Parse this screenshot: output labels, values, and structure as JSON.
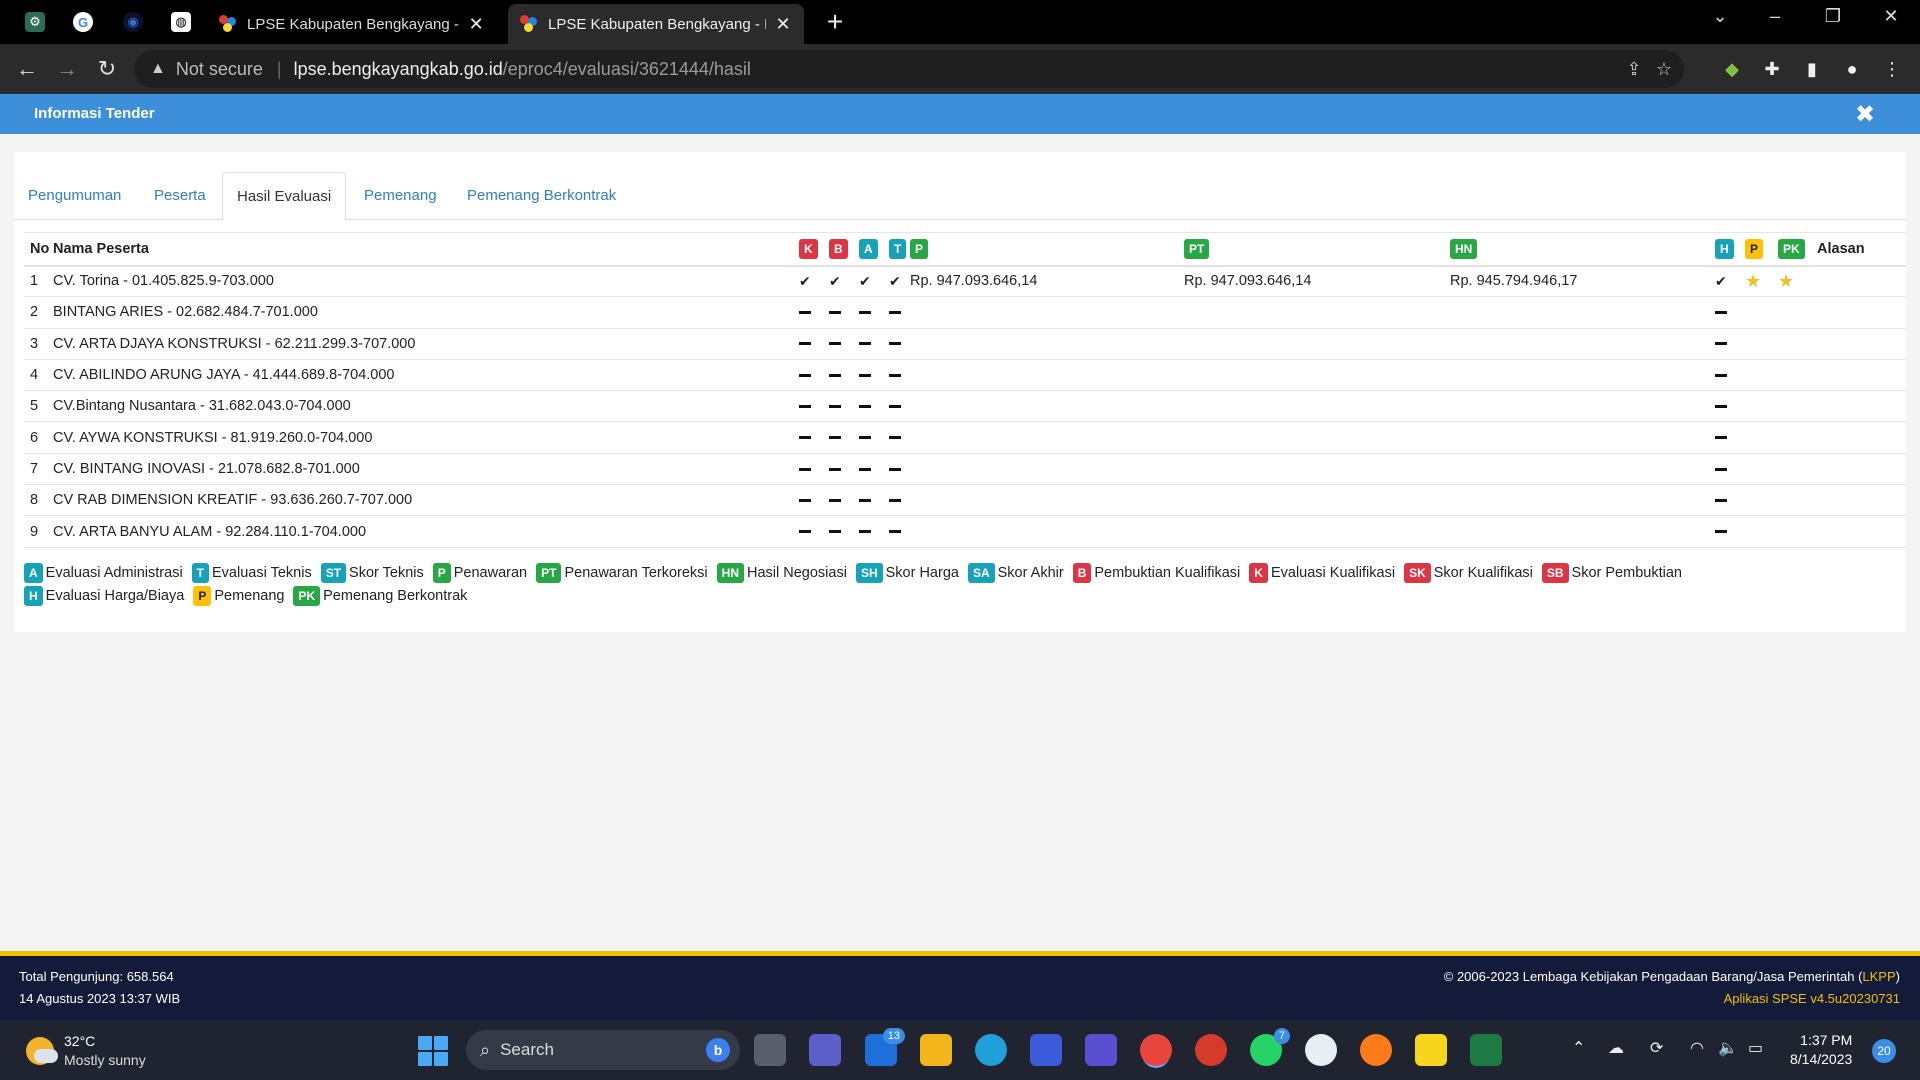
{
  "browser": {
    "tabs": [
      {
        "title": "LPSE Kabupaten Bengkayang - Cari Paket",
        "active": false
      },
      {
        "title": "LPSE Kabupaten Bengkayang - Informasi Tender",
        "active": true
      }
    ],
    "new_tab_label": "+",
    "security_text": "Not secure",
    "url_host": "lpse.bengkayangkab.go.id",
    "url_path": "/eproc4/evaluasi/3621444/hasil"
  },
  "page": {
    "header_title": "Informasi Tender",
    "close_label": "✖"
  },
  "tabs": [
    {
      "label": "Pengumuman"
    },
    {
      "label": "Peserta"
    },
    {
      "label": "Hasil Evaluasi",
      "active": true
    },
    {
      "label": "Pemenang"
    },
    {
      "label": "Pemenang Berkontrak"
    }
  ],
  "table": {
    "col_no": "No",
    "col_name": "Nama Peserta",
    "badge_k": "K",
    "badge_b": "B",
    "badge_a": "A",
    "badge_t": "T",
    "badge_p": "P",
    "badge_pt": "PT",
    "badge_hn": "HN",
    "badge_h": "H",
    "badge_p2": "P",
    "badge_pk": "PK",
    "col_reason": "Alasan",
    "rows": [
      {
        "no": "1",
        "name": "CV. Torina - 01.405.825.9-703.000",
        "marks": [
          "check",
          "check",
          "check",
          "check"
        ],
        "penawaran": "Rp. 947.093.646,14",
        "terkoreksi": "Rp. 947.093.646,14",
        "negosiasi": "Rp. 945.794.946,17",
        "h": "check",
        "p": "star",
        "pk": "star"
      },
      {
        "no": "2",
        "name": "BINTANG ARIES - 02.682.484.7-701.000",
        "marks": [
          "dash",
          "dash",
          "dash",
          "dash"
        ],
        "penawaran": "",
        "terkoreksi": "",
        "negosiasi": "",
        "h": "dash",
        "p": "",
        "pk": ""
      },
      {
        "no": "3",
        "name": "CV. ARTA DJAYA KONSTRUKSI - 62.211.299.3-707.000",
        "marks": [
          "dash",
          "dash",
          "dash",
          "dash"
        ],
        "penawaran": "",
        "terkoreksi": "",
        "negosiasi": "",
        "h": "dash",
        "p": "",
        "pk": ""
      },
      {
        "no": "4",
        "name": "CV. ABILINDO ARUNG JAYA - 41.444.689.8-704.000",
        "marks": [
          "dash",
          "dash",
          "dash",
          "dash"
        ],
        "penawaran": "",
        "terkoreksi": "",
        "negosiasi": "",
        "h": "dash",
        "p": "",
        "pk": ""
      },
      {
        "no": "5",
        "name": "CV.Bintang Nusantara - 31.682.043.0-704.000",
        "marks": [
          "dash",
          "dash",
          "dash",
          "dash"
        ],
        "penawaran": "",
        "terkoreksi": "",
        "negosiasi": "",
        "h": "dash",
        "p": "",
        "pk": ""
      },
      {
        "no": "6",
        "name": "CV. AYWA KONSTRUKSI - 81.919.260.0-704.000",
        "marks": [
          "dash",
          "dash",
          "dash",
          "dash"
        ],
        "penawaran": "",
        "terkoreksi": "",
        "negosiasi": "",
        "h": "dash",
        "p": "",
        "pk": ""
      },
      {
        "no": "7",
        "name": "CV. BINTANG INOVASI - 21.078.682.8-701.000",
        "marks": [
          "dash",
          "dash",
          "dash",
          "dash"
        ],
        "penawaran": "",
        "terkoreksi": "",
        "negosiasi": "",
        "h": "dash",
        "p": "",
        "pk": ""
      },
      {
        "no": "8",
        "name": "CV RAB DIMENSION KREATIF - 93.636.260.7-707.000",
        "marks": [
          "dash",
          "dash",
          "dash",
          "dash"
        ],
        "penawaran": "",
        "terkoreksi": "",
        "negosiasi": "",
        "h": "dash",
        "p": "",
        "pk": ""
      },
      {
        "no": "9",
        "name": "CV. ARTA BANYU ALAM - 92.284.110.1-704.000",
        "marks": [
          "dash",
          "dash",
          "dash",
          "dash"
        ],
        "penawaran": "",
        "terkoreksi": "",
        "negosiasi": "",
        "h": "dash",
        "p": "",
        "pk": ""
      }
    ]
  },
  "legend": [
    {
      "badge": "A",
      "color": "blue",
      "text": "Evaluasi Administrasi"
    },
    {
      "badge": "T",
      "color": "blue",
      "text": "Evaluasi Teknis"
    },
    {
      "badge": "ST",
      "color": "blue",
      "text": "Skor Teknis"
    },
    {
      "badge": "P",
      "color": "green",
      "text": "Penawaran"
    },
    {
      "badge": "PT",
      "color": "green",
      "text": "Penawaran Terkoreksi"
    },
    {
      "badge": "HN",
      "color": "green",
      "text": "Hasil Negosiasi"
    },
    {
      "badge": "SH",
      "color": "blue",
      "text": "Skor Harga"
    },
    {
      "badge": "SA",
      "color": "blue",
      "text": "Skor Akhir"
    },
    {
      "badge": "B",
      "color": "red",
      "text": "Pembuktian Kualifikasi"
    },
    {
      "badge": "K",
      "color": "red",
      "text": "Evaluasi Kualifikasi"
    },
    {
      "badge": "SK",
      "color": "red",
      "text": "Skor Kualifikasi"
    },
    {
      "badge": "SB",
      "color": "red",
      "text": "Skor Pembuktian"
    },
    {
      "badge": "H",
      "color": "blue",
      "text": "Evaluasi Harga/Biaya"
    },
    {
      "badge": "P",
      "color": "yellow",
      "text": "Pemenang"
    },
    {
      "badge": "PK",
      "color": "green",
      "text": "Pemenang Berkontrak"
    }
  ],
  "footer": {
    "visitors": "Total Pengunjung: 658.564",
    "datetime": "14 Agustus 2023 13:37 WIB",
    "copyright_prefix": "© 2006-2023 Lembaga Kebijakan Pengadaan Barang/Jasa Pemerintah (",
    "copyright_link": "LKPP",
    "copyright_suffix": ")",
    "app_version": "Aplikasi SPSE v4.5u20230731"
  },
  "taskbar": {
    "temperature": "32°C",
    "weather": "Mostly sunny",
    "search_placeholder": "Search",
    "mail_badge": "13",
    "whatsapp_badge": "7",
    "time": "1:37 PM",
    "date": "8/14/2023",
    "notifications": "20"
  },
  "colors": {
    "header_blue": "#3d8fd9",
    "badge_red": "#dc3545",
    "badge_blue": "#17a2b8",
    "badge_green": "#28a745",
    "badge_yellow": "#ffc107",
    "footer_navy": "#131a3a",
    "footer_accent": "#f0c000"
  }
}
